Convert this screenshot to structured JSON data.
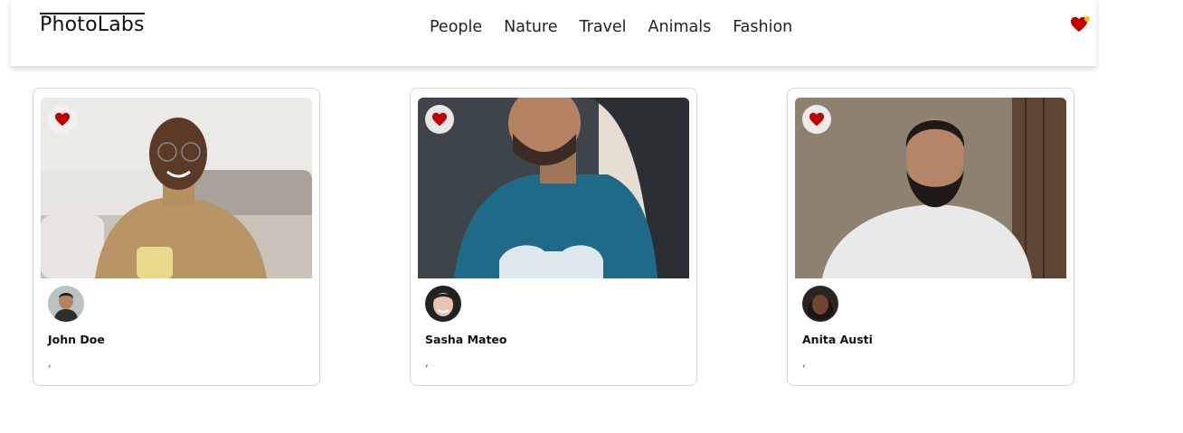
{
  "app": {
    "logo": "PhotoLabs"
  },
  "nav": {
    "items": [
      {
        "label": "People"
      },
      {
        "label": "Nature"
      },
      {
        "label": "Travel"
      },
      {
        "label": "Animals"
      },
      {
        "label": "Fashion"
      }
    ],
    "favorites_icon": "heart-icon",
    "has_notification": true
  },
  "photos": [
    {
      "user": "John Doe",
      "location": ",",
      "liked": true
    },
    {
      "user": "Sasha Mateo",
      "location": ",",
      "liked": true
    },
    {
      "user": "Anita Austi",
      "location": ",",
      "liked": true
    }
  ],
  "colors": {
    "heart": "#c00000",
    "notification_dot": "#f2c200",
    "card_border": "#d5d5d5"
  }
}
